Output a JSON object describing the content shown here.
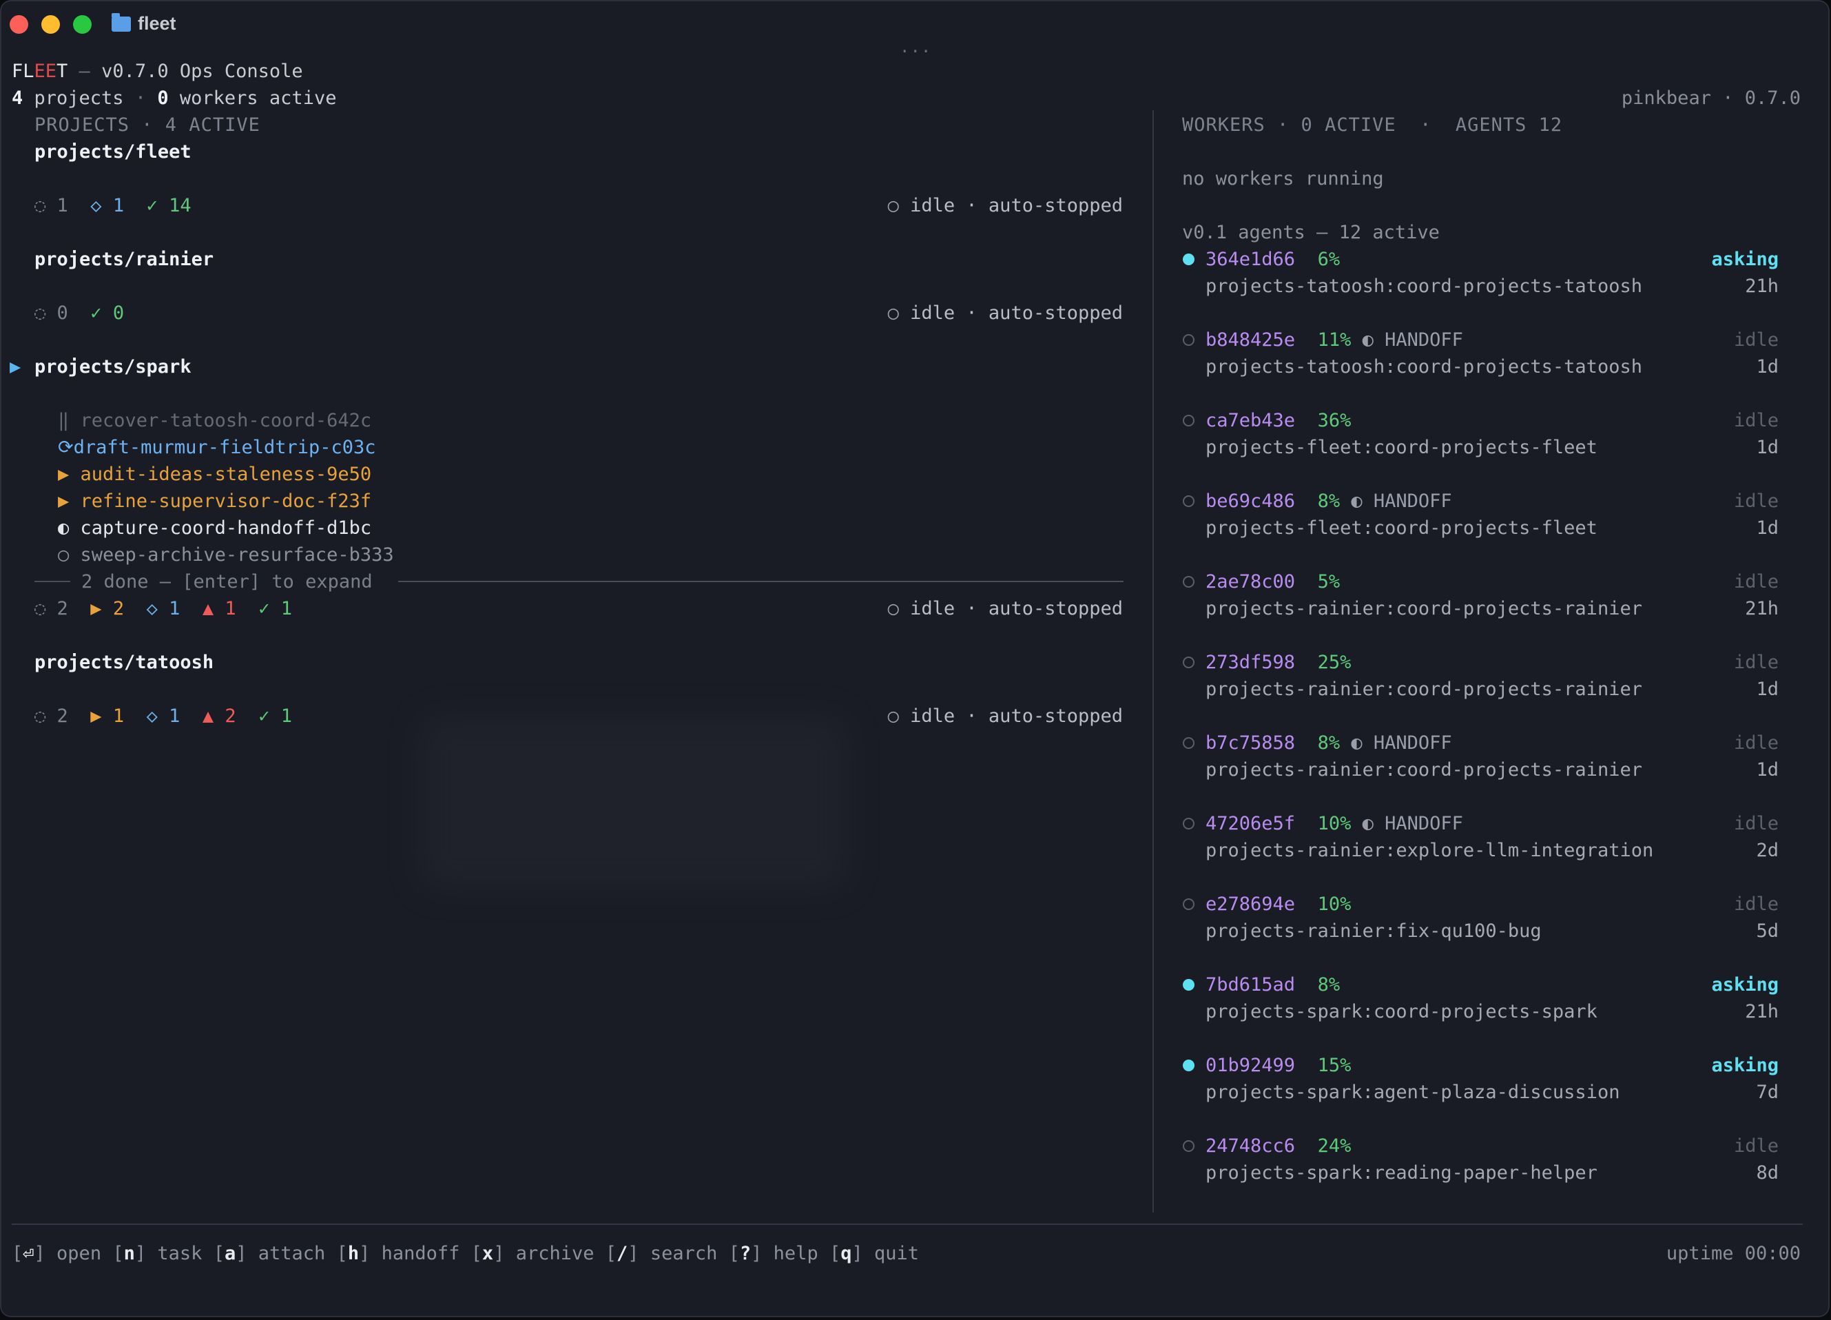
{
  "window": {
    "title": "fleet",
    "dots": "..."
  },
  "header": {
    "brand_fl": "FL",
    "brand_ee": "EE",
    "brand_t": "T",
    "dash": " — ",
    "subtitle": "v0.7.0 Ops Console",
    "project_count": "4",
    "projects_label": " projects",
    "sep": " · ",
    "worker_count": "0",
    "workers_label": " workers active",
    "right": "pinkbear · 0.7.0"
  },
  "projects_panel": {
    "title": "PROJECTS · 4 ACTIVE",
    "fleet": {
      "name": "projects/fleet",
      "todo": "1",
      "review": "1",
      "done": "14",
      "state": "idle · auto-stopped"
    },
    "rainier": {
      "name": "projects/rainier",
      "todo": "0",
      "done": "0",
      "state": "idle · auto-stopped"
    },
    "spark": {
      "name": "projects/spark",
      "selected_marker": "▶",
      "tasks": [
        {
          "icon": "‖",
          "name": "recover-tatoosh-coord-642c"
        },
        {
          "icon": "⟳",
          "name": "draft-murmur-fieldtrip-c03c"
        },
        {
          "icon": "▶",
          "name": "audit-ideas-staleness-9e50"
        },
        {
          "icon": "▶",
          "name": "refine-supervisor-doc-f23f"
        },
        {
          "icon": "◐",
          "name": "capture-coord-handoff-d1bc"
        },
        {
          "icon": "○",
          "name": "sweep-archive-resurface-b333"
        }
      ],
      "done_summary": "2 done — [enter] to expand",
      "todo": "2",
      "running": "2",
      "review": "1",
      "blocked": "1",
      "done": "1",
      "state": "idle · auto-stopped"
    },
    "tatoosh": {
      "name": "projects/tatoosh",
      "todo": "2",
      "running": "1",
      "review": "1",
      "blocked": "2",
      "done": "1",
      "state": "idle · auto-stopped"
    }
  },
  "workers_panel": {
    "title": "WORKERS · 0 ACTIVE  ·  AGENTS 12",
    "empty": "no workers running",
    "agents_heading": "v0.1 agents — 12 active",
    "handoff_label": "HANDOFF",
    "agents": [
      {
        "id": "364e1d66",
        "pct": "6%",
        "status": "asking",
        "path": "projects-tatoosh:coord-projects-tatoosh",
        "age": "21h"
      },
      {
        "id": "b848425e",
        "pct": "11%",
        "status": "idle",
        "path": "projects-tatoosh:coord-projects-tatoosh",
        "age": "1d"
      },
      {
        "id": "ca7eb43e",
        "pct": "36%",
        "status": "idle",
        "path": "projects-fleet:coord-projects-fleet",
        "age": "1d"
      },
      {
        "id": "be69c486",
        "pct": "8%",
        "status": "idle",
        "path": "projects-fleet:coord-projects-fleet",
        "age": "1d"
      },
      {
        "id": "2ae78c00",
        "pct": "5%",
        "status": "idle",
        "path": "projects-rainier:coord-projects-rainier",
        "age": "21h"
      },
      {
        "id": "273df598",
        "pct": "25%",
        "status": "idle",
        "path": "projects-rainier:coord-projects-rainier",
        "age": "1d"
      },
      {
        "id": "b7c75858",
        "pct": "8%",
        "status": "idle",
        "path": "projects-rainier:coord-projects-rainier",
        "age": "1d"
      },
      {
        "id": "47206e5f",
        "pct": "10%",
        "status": "idle",
        "path": "projects-rainier:explore-llm-integration",
        "age": "2d"
      },
      {
        "id": "e278694e",
        "pct": "10%",
        "status": "idle",
        "path": "projects-rainier:fix-qu100-bug",
        "age": "5d"
      },
      {
        "id": "7bd615ad",
        "pct": "8%",
        "status": "asking",
        "path": "projects-spark:coord-projects-spark",
        "age": "21h"
      },
      {
        "id": "01b92499",
        "pct": "15%",
        "status": "asking",
        "path": "projects-spark:agent-plaza-discussion",
        "age": "7d"
      },
      {
        "id": "24748cc6",
        "pct": "24%",
        "status": "idle",
        "path": "projects-spark:reading-paper-helper",
        "age": "8d"
      }
    ]
  },
  "footer": {
    "keys": [
      {
        "key": "⏎",
        "label": "open"
      },
      {
        "key": "n",
        "label": "task"
      },
      {
        "key": "a",
        "label": "attach"
      },
      {
        "key": "h",
        "label": "handoff"
      },
      {
        "key": "x",
        "label": "archive"
      },
      {
        "key": "/",
        "label": "search"
      },
      {
        "key": "?",
        "label": "help"
      },
      {
        "key": "q",
        "label": "quit"
      }
    ],
    "uptime": "uptime 00:00"
  },
  "colors": {
    "background": "#1a1c25",
    "accent_cyan": "#5fe0f0",
    "agent_id": "#b98cf0",
    "percent_green": "#5ec97a",
    "running_blue": "#6db3f2",
    "warn_orange": "#e8a23a",
    "blocked_red": "#ef5b5b",
    "brand_red": "#e24a4a"
  }
}
